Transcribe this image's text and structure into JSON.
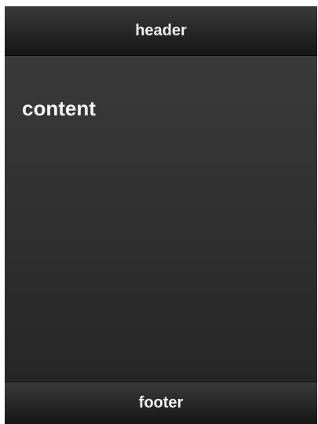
{
  "header": {
    "title": "header"
  },
  "content": {
    "text": "content"
  },
  "footer": {
    "title": "footer"
  }
}
